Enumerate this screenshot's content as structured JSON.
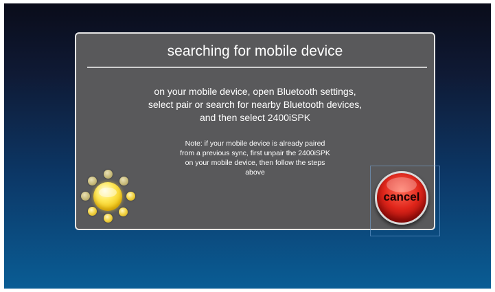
{
  "dialog": {
    "title": "searching for mobile device",
    "instructions": [
      "on your mobile device, open Bluetooth settings,",
      "select pair or search for nearby Bluetooth devices,",
      "and then select 2400iSPK"
    ],
    "note": [
      "Note: if your mobile device is already paired",
      "from a previous sync, first unpair the 2400iSPK",
      "on your mobile device, then follow the steps",
      "above"
    ]
  },
  "cancel_button": {
    "label": "cancel"
  },
  "colors": {
    "dialog_bg": "#59595b",
    "cancel_red": "#e0261b",
    "spinner_yellow": "#f4d64a"
  },
  "icons": {
    "spinner": "loading-spinner-icon"
  }
}
